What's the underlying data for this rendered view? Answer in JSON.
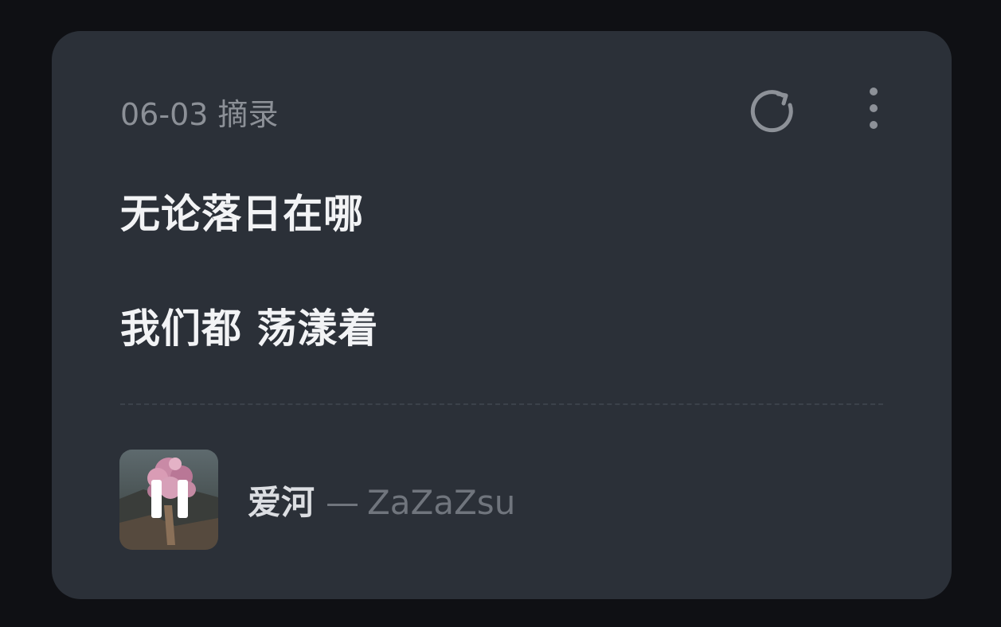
{
  "card": {
    "date_label": "06-03 摘录",
    "lyrics": [
      "无论落日在哪",
      "我们都 荡漾着"
    ],
    "refresh_icon": "refresh-icon",
    "more_icon": "more-vertical-icon"
  },
  "player": {
    "state": "playing",
    "control_icon": "pause-icon",
    "song_title": "爱河",
    "separator": "—",
    "artist": "ZaZaZsu"
  },
  "colors": {
    "background": "#0f1014",
    "card": "#2b3038",
    "lyric_text": "#f2f3f5",
    "muted_text": "#8c9097"
  }
}
